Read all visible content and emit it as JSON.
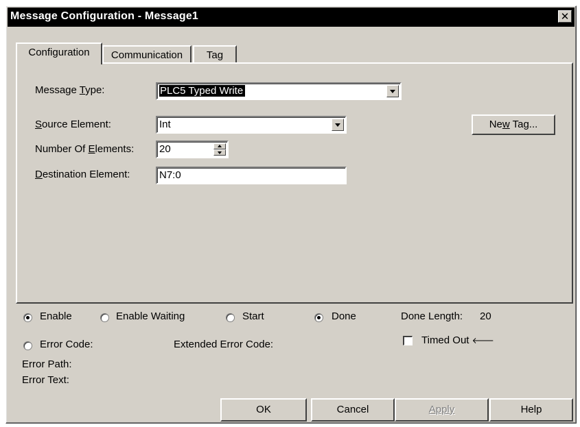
{
  "window": {
    "title": "Message Configuration - Message1",
    "close_glyph": "✕"
  },
  "tabs": [
    {
      "label": "Configuration",
      "active": true
    },
    {
      "label": "Communication",
      "active": false
    },
    {
      "label": "Tag",
      "active": false
    }
  ],
  "form": {
    "message_type": {
      "label_pre": "Message ",
      "label_mnemonic": "T",
      "label_post": "ype:",
      "value": "PLC5 Typed Write"
    },
    "source_element": {
      "label_pre": "",
      "label_mnemonic": "S",
      "label_post": "ource Element:",
      "value": "Int"
    },
    "number_of_elements": {
      "label_pre": "Number Of ",
      "label_mnemonic": "E",
      "label_post": "lements:",
      "value": "20"
    },
    "destination_element": {
      "label_pre": "",
      "label_mnemonic": "D",
      "label_post": "estination Element:",
      "value": "N7:0"
    },
    "new_tag_button": {
      "pre": "Ne",
      "mnemonic": "w",
      "post": " Tag..."
    }
  },
  "status": {
    "enable": {
      "label": "Enable",
      "selected": true
    },
    "enable_waiting": {
      "label": "Enable Waiting",
      "selected": false
    },
    "start": {
      "label": "Start",
      "selected": false
    },
    "done": {
      "label": "Done",
      "selected": true
    },
    "done_length_label": "Done Length:",
    "done_length_value": "20",
    "error_code": {
      "label": "Error Code:",
      "selected": false
    },
    "extended_error_code_label": "Extended Error Code:",
    "timed_out": {
      "label": "Timed Out",
      "checked": false,
      "arrow": "🡐"
    },
    "error_path_label": "Error Path:",
    "error_text_label": "Error Text:"
  },
  "buttons": {
    "ok": "OK",
    "cancel": "Cancel",
    "apply": "Apply",
    "help": "Help"
  }
}
